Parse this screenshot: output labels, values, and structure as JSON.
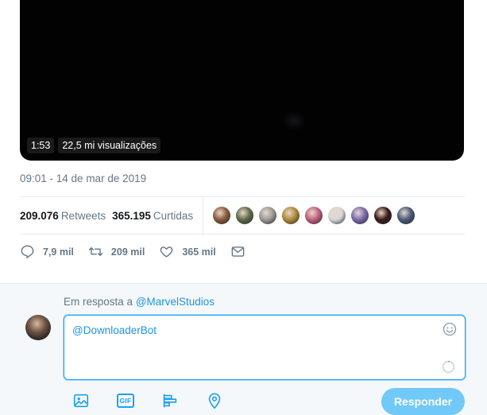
{
  "video": {
    "duration": "1:53",
    "views": "22,5 mi visualizações"
  },
  "tweet": {
    "timestamp": "09:01 - 14 de mar de 2019"
  },
  "stats": {
    "retweets_count": "209.076",
    "retweets_label": "Retweets",
    "likes_count": "365.195",
    "likes_label": "Curtidas",
    "liker_avatar_colors": [
      "#8a5a3c",
      "#5e6b4a",
      "#9a9a9a",
      "#b08a3a",
      "#c06080",
      "#d8d8d8",
      "#7a6ab0",
      "#3a1a1a",
      "#4a5a7a"
    ]
  },
  "actions": {
    "reply_count": "7,9 mil",
    "retweet_count": "209 mil",
    "like_count": "365 mil"
  },
  "reply": {
    "prefix": "Em resposta a",
    "handle": "@MarvelStudios",
    "compose_text": "@DownloaderBot",
    "send_label": "Responder"
  },
  "colors": {
    "accent": "#1da1f2",
    "muted": "#657786",
    "send_disabled": "#71c9f8"
  }
}
